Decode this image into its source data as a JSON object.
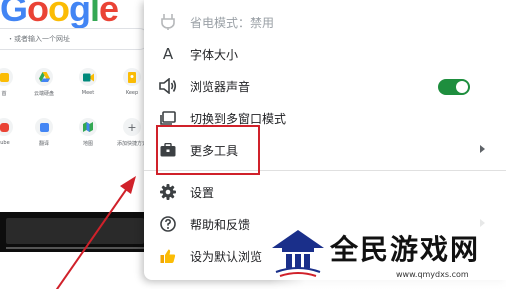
{
  "newtab": {
    "logo_text": "Google",
    "search_placeholder": "・或者输入一个网址",
    "shortcuts": [
      {
        "label": "首",
        "color": "#fbbc05"
      },
      {
        "label": "云端硬盘",
        "color": "#34a853"
      },
      {
        "label": "Meet",
        "color": "#00897b"
      },
      {
        "label": "Keep",
        "color": "#fbbc05"
      },
      {
        "label": "tube",
        "color": "#ea4335"
      },
      {
        "label": "翻译",
        "color": "#4285f4"
      },
      {
        "label": "地图",
        "color": "#34a853"
      },
      {
        "label": "添加快捷方式",
        "color": "#5f6368"
      }
    ]
  },
  "menu": {
    "items": [
      {
        "id": "energy-saver",
        "label": "省电模式：禁用",
        "icon": "plug-icon",
        "disabled": true
      },
      {
        "id": "font-size",
        "label": "字体大小",
        "icon": "font-a-icon"
      },
      {
        "id": "browser-sound",
        "label": "浏览器声音",
        "icon": "speaker-icon",
        "toggle": true
      },
      {
        "id": "multi-window",
        "label": "切换到多窗口模式",
        "icon": "window-icon"
      },
      {
        "id": "more-tools",
        "label": "更多工具",
        "icon": "toolbox-icon",
        "submenu": true
      },
      {
        "id": "settings",
        "label": "设置",
        "icon": "gear-icon"
      },
      {
        "id": "help-feedback",
        "label": "帮助和反馈",
        "icon": "help-circle-icon",
        "submenu": true
      },
      {
        "id": "set-default",
        "label": "设为默认浏览",
        "icon": "thumbs-up-icon"
      }
    ],
    "toggle_state": "on",
    "colors": {
      "toggle_on": "#1e8e3e",
      "highlight": "#d0212a"
    }
  },
  "watermark": {
    "brand": "全民游戏网",
    "url": "www.qmydxs.com"
  }
}
